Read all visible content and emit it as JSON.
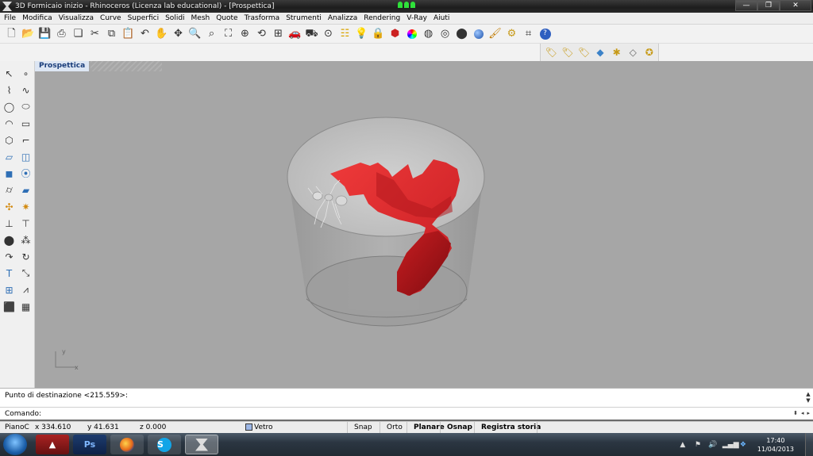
{
  "window": {
    "title": "3D Formicaio inizio  - Rhinoceros (Licenza lab educational) - [Prospettica]",
    "minimize": "—",
    "maximize": "❐",
    "close": "✕"
  },
  "menu": [
    "File",
    "Modifica",
    "Visualizza",
    "Curve",
    "Superfici",
    "Solidi",
    "Mesh",
    "Quote",
    "Trasforma",
    "Strumenti",
    "Analizza",
    "Rendering",
    "V-Ray",
    "Aiuti"
  ],
  "viewport": {
    "tab_label": "Prospettica",
    "axis_x": "x",
    "axis_y": "y"
  },
  "command": {
    "history": "Punto di destinazione <215.559>:",
    "prompt": "Comando:",
    "value": ""
  },
  "status": {
    "cplane": "PianoC",
    "x": "x 334.610",
    "y": "y 41.631",
    "z": "z 0.000",
    "layer": "Vetro",
    "layer_color": "#9db7e6",
    "snap": "Snap",
    "orto": "Orto",
    "planare": "Planare",
    "osnap": "Osnap",
    "registra": "Registra storia"
  },
  "taskbar": {
    "ps_label": "Ps",
    "time": "17:40",
    "date": "11/04/2013"
  },
  "colors": {
    "viewport_bg": "#a6a6a6",
    "ant_body": "#d9d9d9",
    "tunnel_red": "#d4262b"
  }
}
